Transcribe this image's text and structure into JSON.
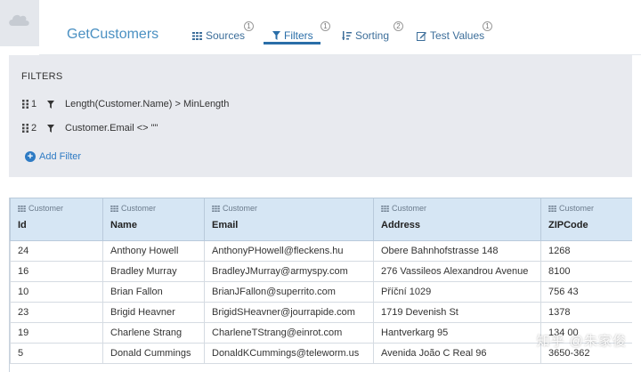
{
  "header": {
    "title": "GetCustomers",
    "tabs": [
      {
        "label": "Sources",
        "icon": "grid-icon",
        "badge": "1"
      },
      {
        "label": "Filters",
        "icon": "funnel-icon",
        "badge": "1"
      },
      {
        "label": "Sorting",
        "icon": "sort-icon",
        "badge": "2"
      },
      {
        "label": "Test Values",
        "icon": "edit-icon",
        "badge": "1"
      }
    ],
    "active_tab": "Filters"
  },
  "filters": {
    "title": "FILTERS",
    "items": [
      {
        "num": "1",
        "expression": "Length(Customer.Name) > MinLength"
      },
      {
        "num": "2",
        "expression": "Customer.Email <> \"\""
      }
    ],
    "add_label": "Add Filter"
  },
  "table": {
    "columns": [
      {
        "entity": "Customer",
        "name": "Id"
      },
      {
        "entity": "Customer",
        "name": "Name"
      },
      {
        "entity": "Customer",
        "name": "Email"
      },
      {
        "entity": "Customer",
        "name": "Address"
      },
      {
        "entity": "Customer",
        "name": "ZIPCode"
      }
    ],
    "rows": [
      [
        "24",
        "Anthony Howell",
        "AnthonyPHowell@fleckens.hu",
        "Obere Bahnhofstrasse 148",
        "1268"
      ],
      [
        "16",
        "Bradley Murray",
        "BradleyJMurray@armyspy.com",
        "276 Vassileos Alexandrou Avenue",
        "8100"
      ],
      [
        "10",
        "Brian Fallon",
        "BrianJFallon@superrito.com",
        "Příční 1029",
        "756 43"
      ],
      [
        "23",
        "Brigid Heavner",
        "BrigidSHeavner@jourrapide.com",
        "1719 Devenish St",
        "1378"
      ],
      [
        "19",
        "Charlene Strang",
        "CharleneTStrang@einrot.com",
        "Hantverkarg 95",
        "134 00"
      ],
      [
        "5",
        "Donald Cummings",
        "DonaldKCummings@teleworm.us",
        "Avenida João C Real 96",
        "3650-362"
      ]
    ]
  },
  "watermark": "知乎 @朱家俊",
  "colors": {
    "accent": "#2a6ea8",
    "header_bg": "#d6e6f4",
    "filters_bg": "#e8eaef"
  }
}
